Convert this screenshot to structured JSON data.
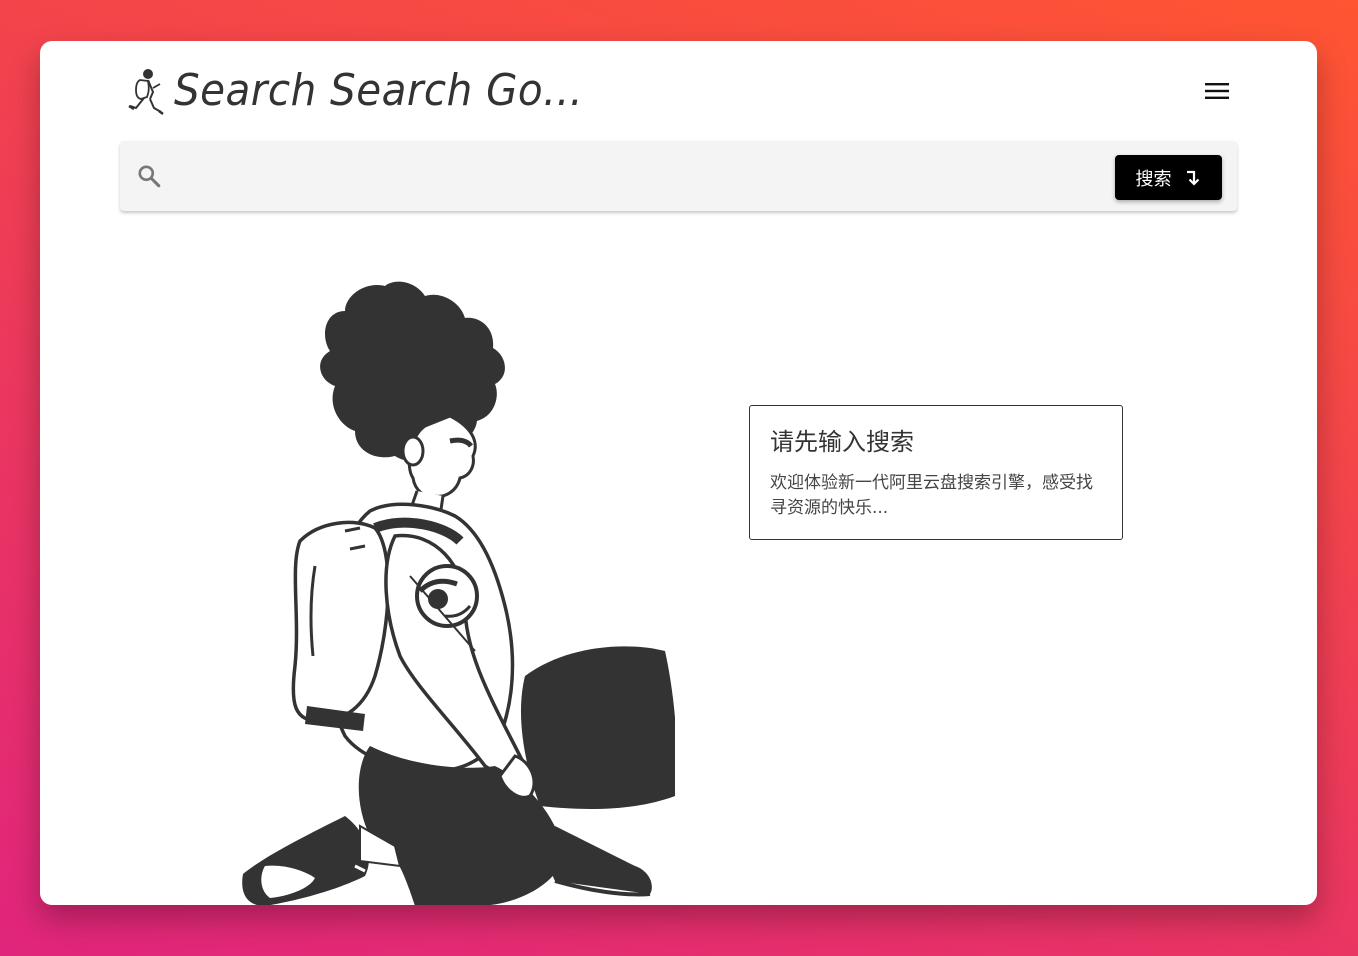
{
  "app": {
    "title": "Search Search Go...",
    "logo_icon": "running-hiker-logo-icon",
    "menu_icon": "hamburger-menu-icon"
  },
  "search": {
    "placeholder": "",
    "value": "",
    "button_label": "搜索",
    "search_icon": "search-icon",
    "button_icon": "return-arrow-icon"
  },
  "empty_state": {
    "title": "请先输入搜索",
    "description": "欢迎体验新一代阿里云盘搜索引擎，感受找寻资源的快乐..."
  },
  "illustration": {
    "subject": "kneeling-person-with-backpack-illustration"
  },
  "colors": {
    "background_gradient_start": "#e0257c",
    "background_gradient_end": "#ff5532",
    "window": "#ffffff",
    "search_bar": "#f4f4f4",
    "button": "#000000",
    "ink": "#333333"
  }
}
